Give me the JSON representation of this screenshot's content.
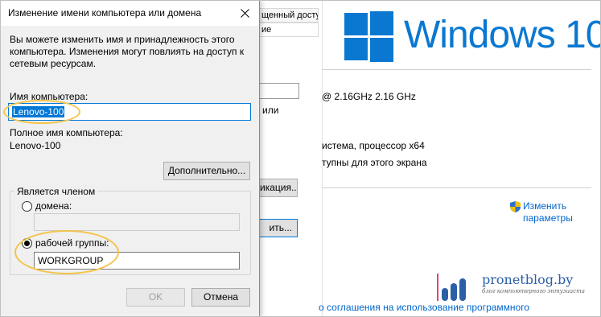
{
  "background": {
    "tab_top": "щенный доступ",
    "tab_second": "ие",
    "text_or": "или",
    "processor_speed": "@ 2.16GHz   2.16 GHz",
    "system_type": "истема, процессор x64",
    "touch_info": "тупны для этого экрана",
    "identification_button": "икация...",
    "change_button": "ить...",
    "windows_title": "Windows 10",
    "change_params_line1": "Изменить",
    "change_params_line2": "параметры",
    "license_link": "о соглашения на использование программного",
    "brand_color": "#0a78d1"
  },
  "watermark": {
    "site": "pronetblog.by",
    "tagline": "блог компьютерного энтузиаста"
  },
  "dialog": {
    "title": "Изменение имени компьютера или домена",
    "description": "Вы можете изменить имя и принадлежность этого компьютера. Изменения могут повлиять на доступ к сетевым ресурсам.",
    "computer_name_label": "Имя компьютера:",
    "computer_name_value": "Lenovo-100",
    "full_name_label": "Полное имя компьютера:",
    "full_name_value": "Lenovo-100",
    "more_button": "Дополнительно...",
    "member_of_label": "Является членом",
    "domain_label": "домена:",
    "domain_value": "",
    "workgroup_label": "рабочей группы:",
    "workgroup_value": "WORKGROUP",
    "workgroup_selected": true,
    "ok_button": "OK",
    "cancel_button": "Отмена"
  }
}
